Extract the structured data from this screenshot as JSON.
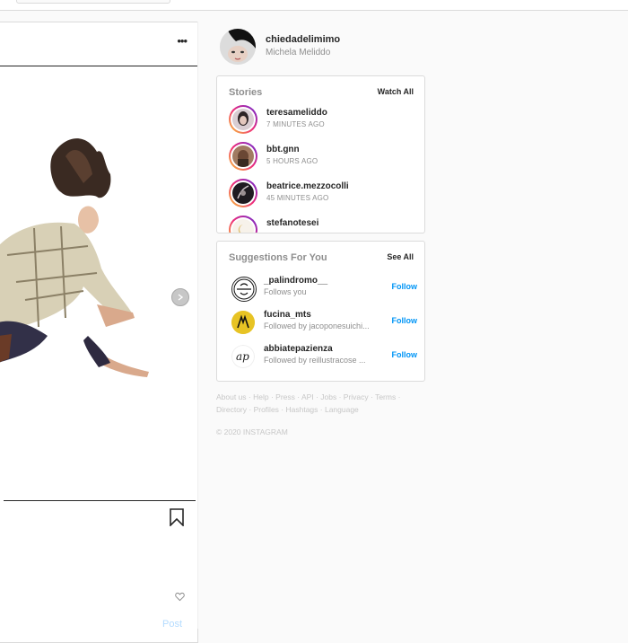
{
  "colors": {
    "accent": "#0095f6",
    "muted": "#8e8e8e",
    "border": "#dbdbdb",
    "post_disabled": "#b3dbff"
  },
  "post": {
    "more_icon": "more-horizontal-icon",
    "next_icon": "chevron-right-icon",
    "bookmark_icon": "bookmark-icon",
    "like_icon": "heart-icon",
    "post_label": "Post"
  },
  "profile": {
    "username": "chiedadelimimo",
    "full_name": "Michela Meliddo"
  },
  "stories": {
    "title": "Stories",
    "action": "Watch All",
    "items": [
      {
        "username": "teresameliddo",
        "time": "7 MINUTES AGO"
      },
      {
        "username": "bbt.gnn",
        "time": "5 HOURS AGO"
      },
      {
        "username": "beatrice.mezzocolli",
        "time": "45 MINUTES AGO"
      },
      {
        "username": "stefanotesei",
        "time": ""
      }
    ]
  },
  "suggestions": {
    "title": "Suggestions For You",
    "action": "See All",
    "items": [
      {
        "username": "_palindromo__",
        "subtitle": "Follows you",
        "button": "Follow"
      },
      {
        "username": "fucina_mts",
        "subtitle": "Followed by jacoponesuichi...",
        "button": "Follow"
      },
      {
        "username": "abbiatepazienza",
        "subtitle": "Followed by reillustracose ...",
        "button": "Follow"
      }
    ]
  },
  "footer": {
    "links": [
      "About us",
      "Help",
      "Press",
      "API",
      "Jobs",
      "Privacy",
      "Terms",
      "Directory",
      "Profiles",
      "Hashtags",
      "Language"
    ],
    "copyright": "© 2020 INSTAGRAM"
  }
}
